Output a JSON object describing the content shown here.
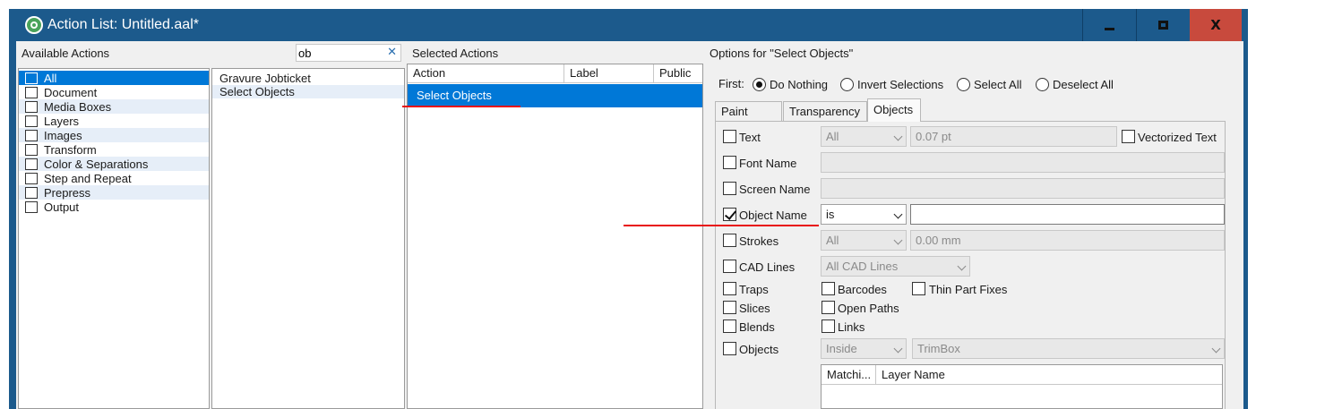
{
  "window": {
    "title": "Action List: Untitled.aal*",
    "buttons": {
      "minimize": "minimize",
      "maximize": "maximize",
      "close": "X"
    }
  },
  "left_pane": {
    "title": "Available Actions",
    "search": {
      "value": "ob",
      "clear": "✕"
    },
    "categories": [
      {
        "label": "All",
        "icon": "list-icon",
        "selected": true
      },
      {
        "label": "Document",
        "icon": "document-icon"
      },
      {
        "label": "Media Boxes",
        "icon": "media-box-icon"
      },
      {
        "label": "Layers",
        "icon": "layers-icon"
      },
      {
        "label": "Images",
        "icon": "image-icon"
      },
      {
        "label": "Transform",
        "icon": "transform-icon"
      },
      {
        "label": "Color & Separations",
        "icon": "color-icon"
      },
      {
        "label": "Step and Repeat",
        "icon": "step-repeat-icon"
      },
      {
        "label": "Prepress",
        "icon": "gear-icon"
      },
      {
        "label": "Output",
        "icon": "printer-icon"
      }
    ],
    "actions": [
      "Gravure Jobticket",
      "Select Objects"
    ]
  },
  "middle_pane": {
    "title": "Selected Actions",
    "columns": [
      "Action",
      "Label",
      "Public"
    ],
    "rows": [
      {
        "action": "Select Objects",
        "label": "",
        "public": ""
      }
    ]
  },
  "right_pane": {
    "title": "Options for \"Select Objects\"",
    "first": {
      "label": "First:",
      "options": [
        "Do Nothing",
        "Invert Selections",
        "Select All",
        "Deselect All"
      ],
      "selected": "Do Nothing"
    },
    "tabs": [
      "Paint Style",
      "Transparency",
      "Objects"
    ],
    "active_tab": "Objects",
    "objects": {
      "text": {
        "label": "Text",
        "checked": false,
        "mode": "All",
        "size": "0.07 pt",
        "vectorized_label": "Vectorized Text",
        "vectorized_checked": false
      },
      "font_name": {
        "label": "Font Name",
        "checked": false,
        "value": ""
      },
      "screen_name": {
        "label": "Screen Name",
        "checked": false,
        "value": ""
      },
      "object_name": {
        "label": "Object Name",
        "checked": true,
        "operator": "is",
        "value": ""
      },
      "strokes": {
        "label": "Strokes",
        "checked": false,
        "mode": "All",
        "size": "0.00 mm"
      },
      "cad_lines": {
        "label": "CAD Lines",
        "checked": false,
        "mode": "All CAD Lines"
      },
      "traps": {
        "label": "Traps",
        "checked": false
      },
      "barcodes": {
        "label": "Barcodes",
        "checked": false
      },
      "thin_part_fixes": {
        "label": "Thin Part Fixes",
        "checked": false
      },
      "slices": {
        "label": "Slices",
        "checked": false
      },
      "open_paths": {
        "label": "Open Paths",
        "checked": false
      },
      "blends": {
        "label": "Blends",
        "checked": false
      },
      "links": {
        "label": "Links",
        "checked": false
      },
      "objects": {
        "label": "Objects",
        "checked": false,
        "position": "Inside",
        "box": "TrimBox"
      },
      "layer_table": {
        "columns": [
          "Matchi...",
          "Layer Name"
        ]
      }
    }
  },
  "colors": {
    "titlebar": "#1c5a8c",
    "selection": "#0078d7",
    "close_button": "#c84a3d",
    "annotation": "#e81010"
  }
}
